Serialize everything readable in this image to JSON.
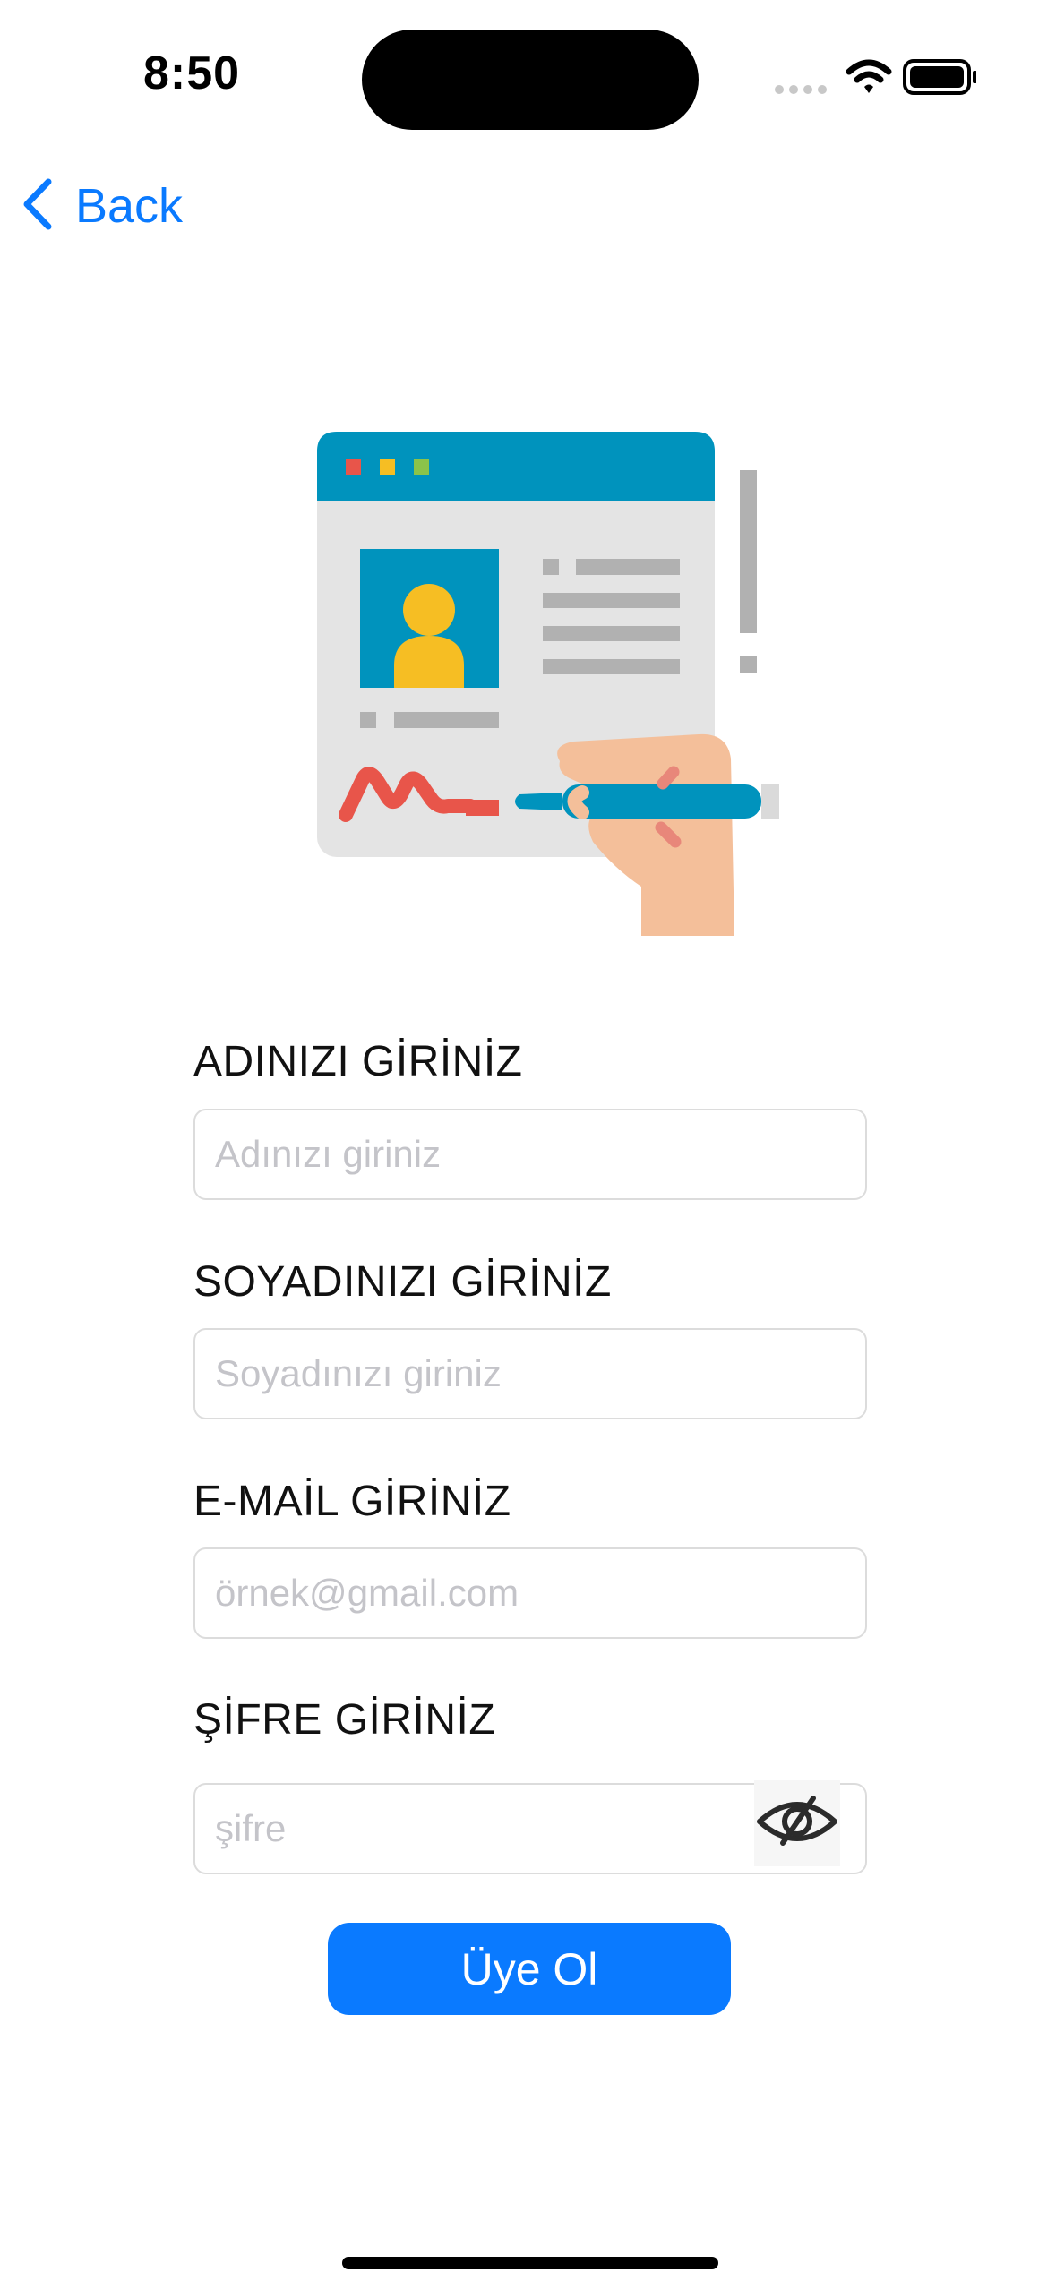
{
  "status_bar": {
    "time": "8:50",
    "icons": [
      "signal-icon",
      "wifi-icon",
      "battery-icon"
    ]
  },
  "nav": {
    "back_label": "Back",
    "back_icon": "chevron-left-icon"
  },
  "illustration": {
    "name": "signup-form-illustration"
  },
  "form": {
    "first_name": {
      "label": "ADINIZI GİRİNİZ",
      "placeholder": "Adınızı giriniz",
      "value": ""
    },
    "last_name": {
      "label": "SOYADINIZI GİRİNİZ",
      "placeholder": "Soyadınızı giriniz",
      "value": ""
    },
    "email": {
      "label": "E-MAİL GİRİNİZ",
      "placeholder": "örnek@gmail.com",
      "value": ""
    },
    "password": {
      "label": "ŞİFRE GİRİNİZ",
      "placeholder": "şifre",
      "value": "",
      "toggle_icon": "eye-slash-icon"
    },
    "submit_label": "Üye Ol"
  },
  "colors": {
    "accent": "#0a7aff",
    "illustration_teal": "#0093bd",
    "illustration_yellow": "#f6be23",
    "illustration_skin": "#f4bf9a",
    "illustration_red": "#e8554a"
  }
}
